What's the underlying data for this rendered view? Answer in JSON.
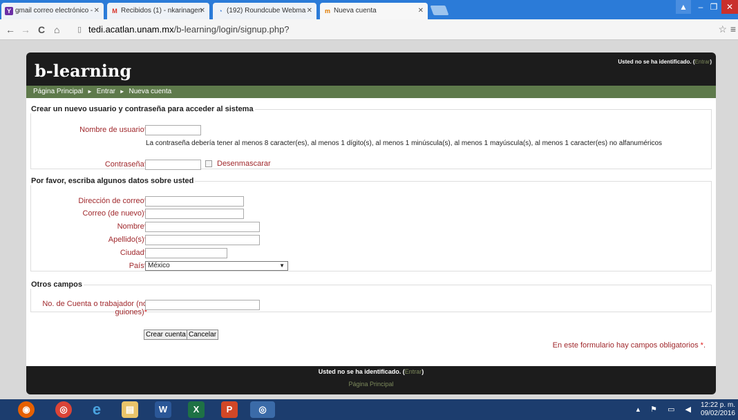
{
  "browser": {
    "tabs": [
      {
        "title": "gmail correo electrónico -",
        "icon_text": "Y",
        "icon_color": "#6b2fa6"
      },
      {
        "title": "Recibidos (1) - nkarinagen",
        "icon_text": "M",
        "icon_color": "#d93025"
      },
      {
        "title": "(192) Roundcube Webma",
        "icon_text": "◔",
        "icon_color": "#3a7bd5"
      },
      {
        "title": "Nueva cuenta",
        "icon_text": "m",
        "icon_color": "#e07a00"
      }
    ],
    "url_host": "tedi.acatlan.unam.mx",
    "url_path": "/b-learning/login/signup.php?"
  },
  "header": {
    "brand": "b-learning",
    "login_text": "Usted no se ha identificado. (",
    "login_link": "Entrar",
    "login_close": ")"
  },
  "breadcrumb": {
    "home": "Página Principal",
    "sep": "►",
    "login": "Entrar",
    "current": "Nueva cuenta"
  },
  "form": {
    "section1": {
      "legend": "Crear un nuevo usuario y contraseña para acceder al sistema",
      "username_label": "Nombre de usuario",
      "password_note": "La contraseña debería tener al menos 8 caracter(es), al menos 1 dígito(s), al menos 1 minúscula(s), al menos 1 mayúscula(s), al menos 1 caracter(es) no alfanuméricos",
      "password_label": "Contraseña",
      "unmask_label": "Desenmascarar"
    },
    "section2": {
      "legend": "Por favor, escriba algunos datos sobre usted",
      "email_label": "Dirección de correo",
      "email2_label": "Correo (de nuevo)",
      "firstname_label": "Nombre",
      "lastname_label": "Apellido(s)",
      "city_label": "Ciudad",
      "country_label": "País",
      "country_value": "México"
    },
    "section3": {
      "legend": "Otros campos",
      "account_label_1": "No. de Cuenta o trabajador (no",
      "account_label_2": "guiones)"
    },
    "required_mark": "*",
    "submit_label": "Crear cuenta",
    "cancel_label": "Cancelar",
    "required_note": "En este formulario hay campos obligatorios",
    "required_note_end": "."
  },
  "footer": {
    "login_text": "Usted no se ha identificado. (",
    "login_link": "Entrar",
    "login_close": ")",
    "home_link": "Página Principal"
  },
  "taskbar": {
    "time": "12:22 p. m.",
    "date": "09/02/2016"
  }
}
